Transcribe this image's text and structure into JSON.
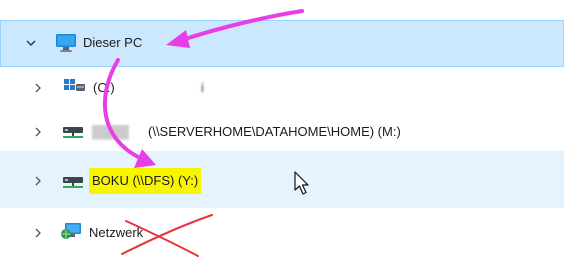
{
  "nav_tree": {
    "this_pc": {
      "label": "Dieser PC",
      "expanded": true,
      "icon": "computer-icon"
    },
    "drives": [
      {
        "label": "(C:)",
        "prefix": "",
        "icon": "windows-drive-icon",
        "obscured_text": "i"
      },
      {
        "label": "(\\\\SERVERHOME\\DATAHOME\\HOME) (M:)",
        "prefix": "▒▒▒▒",
        "icon": "network-drive-icon"
      },
      {
        "label": "BOKU (\\\\DFS) (Y:)",
        "prefix": "",
        "icon": "network-drive-icon",
        "highlighted": true
      }
    ],
    "network": {
      "label": "Netzwerk",
      "icon": "network-icon",
      "crossed_out": true
    }
  },
  "annotations": {
    "arrow_color": "#e83ee8",
    "cross_color": "#e8333a",
    "highlight_color": "#f7f500"
  }
}
